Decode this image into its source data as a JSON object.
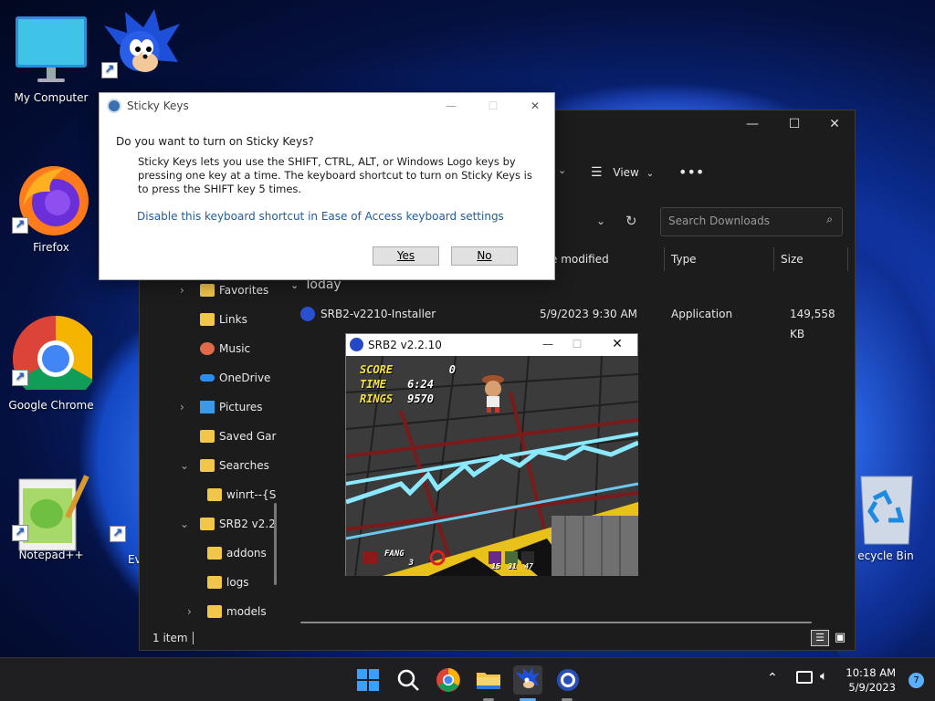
{
  "desktop": {
    "icons": [
      {
        "label": "My Computer"
      },
      {
        "label": "Firefox"
      },
      {
        "label": "Google Chrome"
      },
      {
        "label": "Notepad++"
      },
      {
        "label": "Ev"
      },
      {
        "label": "ecycle Bin"
      }
    ]
  },
  "sticky_dialog": {
    "title": "Sticky Keys",
    "question": "Do you want to turn on Sticky Keys?",
    "description": "Sticky Keys lets you use the SHIFT, CTRL, ALT, or Windows Logo keys by pressing one key at a time. The keyboard shortcut to turn on Sticky Keys is to press the SHIFT key 5 times.",
    "link": "Disable this keyboard shortcut in Ease of Access keyboard settings",
    "yes_label": "Yes",
    "no_label": "No"
  },
  "explorer": {
    "view_label": "View",
    "search_placeholder": "Search Downloads",
    "columns": {
      "modified": "e modified",
      "type": "Type",
      "size": "Size"
    },
    "group_label": "Today",
    "file": {
      "name": "SRB2-v2210-Installer",
      "modified": "5/9/2023 9:30 AM",
      "type": "Application",
      "size": "149,558 KB"
    },
    "nav_items": [
      "Favorites",
      "Links",
      "Music",
      "OneDrive",
      "Pictures",
      "Saved Gar",
      "Searches",
      "winrt--{S",
      "SRB2 v2.2",
      "addons",
      "logs",
      "models"
    ],
    "status": "1 item"
  },
  "game": {
    "title": "SRB2 v2.2.10",
    "hud": {
      "score_label": "SCORE",
      "score": "0",
      "time_label": "TIME",
      "time": "6:24",
      "rings_label": "RINGS",
      "rings": "9570",
      "character": "FANG",
      "lives": "3",
      "emblems": [
        "15",
        "31",
        "47"
      ]
    }
  },
  "taskbar": {
    "time": "10:18 AM",
    "date": "5/9/2023",
    "notification_count": "7"
  },
  "colors": {
    "accent": "#1f5c9c",
    "folder": "#f2c54b",
    "taskbar": "#1f1f22"
  }
}
